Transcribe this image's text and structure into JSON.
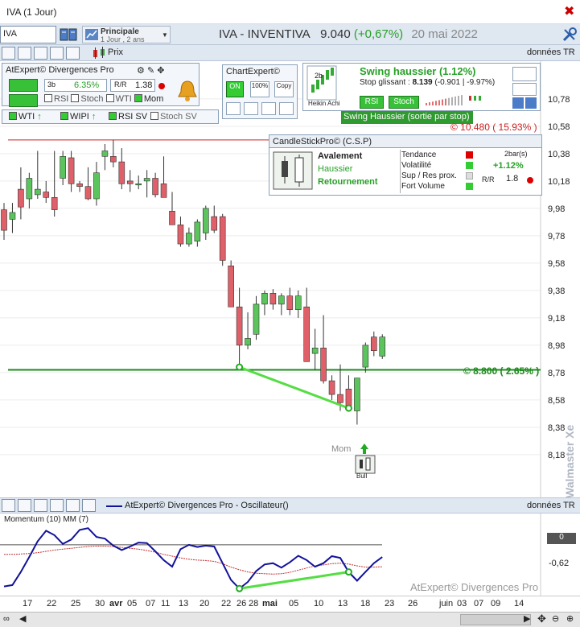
{
  "window": {
    "title": "IVA (1 Jour)",
    "close": "✖"
  },
  "toolbar": {
    "symbol": "IVA",
    "timeframe_title": "Principale",
    "timeframe_detail": "1 Jour , 2 ans",
    "quote_name": "IVA - INVENTIVA",
    "quote_price": "9.040",
    "quote_change": "(+0,67%)",
    "quote_date": "20 mai 2022"
  },
  "toolbar2": {
    "price_label": "Prix",
    "data_label": "données TR"
  },
  "atexpert": {
    "title": "AtExpert© Divergences Pro",
    "pct": "6.35%",
    "ratio": "1.38",
    "bars_label": "3b",
    "checks": [
      {
        "label": "RSI",
        "on": false
      },
      {
        "label": "Stoch",
        "on": false
      },
      {
        "label": "WTI",
        "on": false
      },
      {
        "label": "Mom",
        "on": true
      }
    ],
    "flags": [
      {
        "label": "WTI",
        "arrow": "↑"
      },
      {
        "label": "WIPI",
        "arrow": "↑"
      },
      {
        "label": "RSI SV",
        "arrow": ""
      },
      {
        "label": "Stoch SV",
        "arrow": ""
      }
    ]
  },
  "chartexpert": {
    "title": "ChartExpert©",
    "b1": "ON",
    "b2": "100%",
    "b3": "Copy",
    "heikin": "Heikin Achi",
    "heikin_2b": "2b",
    "swing_title": "Swing haussier (1.12%)",
    "stop_label": "Stop glissant : ",
    "stop_value": "8.139",
    "stop_change": "(-0.901 | -9.97%)",
    "rsi": "RSI",
    "stoch": "Stoch",
    "sortie": "Swing Haussier (sortie par stop)"
  },
  "candlestick": {
    "title": "CandleStickPro© (C.S.P)",
    "pattern": "Avalement",
    "trend": "Haussier",
    "signal": "Retournement",
    "rows": [
      "Tendance",
      "Volatilité",
      "Sup / Res prox.",
      "Fort Volume"
    ],
    "bars": "2bar(s)",
    "change": "+1.12%",
    "ratio": "1.8"
  },
  "levels": {
    "resistance": "© 10.480 ( 15.93% )",
    "support": "© 8.800 ( 2.65% )"
  },
  "chart_data": {
    "type": "candlestick",
    "y_ticks": [
      "10,78",
      "10,58",
      "10,38",
      "10,18",
      "9,98",
      "9,78",
      "9,58",
      "9,38",
      "9,18",
      "8,98",
      "8,78",
      "8,58",
      "8,38",
      "8,18"
    ],
    "ylim": [
      8.05,
      10.85
    ],
    "candles": [
      {
        "o": 9.97,
        "h": 10.02,
        "l": 9.75,
        "c": 9.82
      },
      {
        "o": 9.9,
        "h": 10.02,
        "l": 9.8,
        "c": 9.95
      },
      {
        "o": 10.12,
        "h": 10.28,
        "l": 9.9,
        "c": 9.99
      },
      {
        "o": 10.05,
        "h": 10.24,
        "l": 9.98,
        "c": 10.2
      },
      {
        "o": 10.08,
        "h": 10.4,
        "l": 10.05,
        "c": 10.12
      },
      {
        "o": 10.1,
        "h": 10.18,
        "l": 10.02,
        "c": 10.06
      },
      {
        "o": 10.06,
        "h": 10.4,
        "l": 9.92,
        "c": 9.97
      },
      {
        "o": 10.2,
        "h": 10.4,
        "l": 10.15,
        "c": 10.36
      },
      {
        "o": 10.35,
        "h": 10.4,
        "l": 10.1,
        "c": 10.16
      },
      {
        "o": 10.16,
        "h": 10.18,
        "l": 10.1,
        "c": 10.14
      },
      {
        "o": 10.14,
        "h": 10.28,
        "l": 10.04,
        "c": 10.05
      },
      {
        "o": 10.05,
        "h": 10.32,
        "l": 10.0,
        "c": 10.24
      },
      {
        "o": 10.36,
        "h": 10.45,
        "l": 10.26,
        "c": 10.4
      },
      {
        "o": 10.36,
        "h": 10.48,
        "l": 10.28,
        "c": 10.32
      },
      {
        "o": 10.32,
        "h": 10.42,
        "l": 10.12,
        "c": 10.16
      },
      {
        "o": 10.18,
        "h": 10.26,
        "l": 10.1,
        "c": 10.16
      },
      {
        "o": 10.16,
        "h": 10.22,
        "l": 10.12,
        "c": 10.16
      },
      {
        "o": 10.18,
        "h": 10.26,
        "l": 10.06,
        "c": 10.2
      },
      {
        "o": 10.2,
        "h": 10.24,
        "l": 10.06,
        "c": 10.08
      },
      {
        "o": 10.16,
        "h": 10.36,
        "l": 10.06,
        "c": 10.06
      },
      {
        "o": 9.96,
        "h": 10.1,
        "l": 9.9,
        "c": 9.86
      },
      {
        "o": 9.86,
        "h": 9.92,
        "l": 9.7,
        "c": 9.72
      },
      {
        "o": 9.72,
        "h": 9.84,
        "l": 9.7,
        "c": 9.8
      },
      {
        "o": 9.74,
        "h": 9.9,
        "l": 9.7,
        "c": 9.88
      },
      {
        "o": 9.8,
        "h": 10.0,
        "l": 9.75,
        "c": 9.98
      },
      {
        "o": 9.92,
        "h": 10.0,
        "l": 9.8,
        "c": 9.82
      },
      {
        "o": 9.92,
        "h": 9.94,
        "l": 9.56,
        "c": 9.6
      },
      {
        "o": 9.56,
        "h": 9.6,
        "l": 9.26,
        "c": 9.26
      },
      {
        "o": 9.26,
        "h": 9.4,
        "l": 8.82,
        "c": 8.98
      },
      {
        "o": 8.98,
        "h": 9.22,
        "l": 8.95,
        "c": 9.03
      },
      {
        "o": 9.06,
        "h": 9.34,
        "l": 9.02,
        "c": 9.28
      },
      {
        "o": 9.28,
        "h": 9.38,
        "l": 9.2,
        "c": 9.36
      },
      {
        "o": 9.36,
        "h": 9.39,
        "l": 9.24,
        "c": 9.28
      },
      {
        "o": 9.28,
        "h": 9.36,
        "l": 9.2,
        "c": 9.34
      },
      {
        "o": 9.34,
        "h": 9.4,
        "l": 9.2,
        "c": 9.24
      },
      {
        "o": 9.24,
        "h": 9.38,
        "l": 9.18,
        "c": 9.34
      },
      {
        "o": 9.26,
        "h": 9.4,
        "l": 8.86,
        "c": 8.86
      },
      {
        "o": 8.92,
        "h": 9.1,
        "l": 8.8,
        "c": 8.96
      },
      {
        "o": 8.96,
        "h": 9.2,
        "l": 8.7,
        "c": 8.72
      },
      {
        "o": 8.72,
        "h": 8.76,
        "l": 8.58,
        "c": 8.62
      },
      {
        "o": 8.62,
        "h": 8.84,
        "l": 8.5,
        "c": 8.56
      },
      {
        "o": 8.66,
        "h": 8.76,
        "l": 8.52,
        "c": 8.54
      },
      {
        "o": 8.5,
        "h": 8.7,
        "l": 8.4,
        "c": 8.74
      },
      {
        "o": 8.82,
        "h": 9.0,
        "l": 8.78,
        "c": 8.98
      },
      {
        "o": 9.04,
        "h": 9.08,
        "l": 8.9,
        "c": 8.94
      },
      {
        "o": 8.9,
        "h": 9.06,
        "l": 8.88,
        "c": 9.04
      }
    ],
    "divergence": {
      "from_index": 28,
      "to_index": 41
    },
    "mom_label": "Mom",
    "bull_label": "Bull"
  },
  "oscillator": {
    "header": "AtExpert© Divergences Pro - Oscillateur()",
    "indicator": "Momentum (10) MM (7)",
    "data_label": "données TR",
    "y_ticks": [
      "0",
      "-0,62"
    ],
    "watermark": "AtExpert© Divergences Pro",
    "ylim": [
      -1.05,
      0.42
    ],
    "momentum": [
      -0.95,
      -0.92,
      -0.62,
      -0.28,
      0.08,
      0.32,
      0.22,
      0.02,
      0.12,
      0.34,
      0.38,
      0.18,
      0.14,
      -0.02,
      -0.12,
      -0.04,
      0.05,
      0.04,
      -0.15,
      -0.35,
      -0.5,
      -0.1,
      0.0,
      -0.05,
      -0.02,
      -0.04,
      -0.42,
      -0.8,
      -1.0,
      -0.85,
      -0.6,
      -0.45,
      -0.42,
      -0.52,
      -0.4,
      -0.25,
      -0.35,
      -0.5,
      -0.42,
      -0.26,
      -0.3,
      -0.62,
      -0.82,
      -0.62,
      -0.42,
      -0.28
    ],
    "average": [
      -0.22,
      -0.22,
      -0.21,
      -0.2,
      -0.18,
      -0.15,
      -0.12,
      -0.1,
      -0.08,
      -0.06,
      -0.04,
      -0.03,
      -0.03,
      -0.04,
      -0.06,
      -0.08,
      -0.1,
      -0.13,
      -0.17,
      -0.22,
      -0.26,
      -0.3,
      -0.33,
      -0.35,
      -0.36,
      -0.38,
      -0.43,
      -0.51,
      -0.57,
      -0.62,
      -0.65,
      -0.66,
      -0.67,
      -0.66,
      -0.63,
      -0.58,
      -0.53,
      -0.48,
      -0.46,
      -0.43,
      -0.42,
      -0.44,
      -0.48,
      -0.51,
      -0.51,
      -0.5
    ],
    "divergence": {
      "from_index": 28,
      "to_index": 41
    }
  },
  "xaxis": {
    "labels": [
      "17",
      "22",
      "25",
      "30",
      "avr",
      "05",
      "07",
      "11",
      "13",
      "20",
      "22",
      "26",
      "28",
      "mai",
      "05",
      "10",
      "13",
      "18",
      "23",
      "26",
      "juin",
      "03",
      "07",
      "09",
      "14"
    ]
  },
  "side_watermark": "Walmaster Xe"
}
